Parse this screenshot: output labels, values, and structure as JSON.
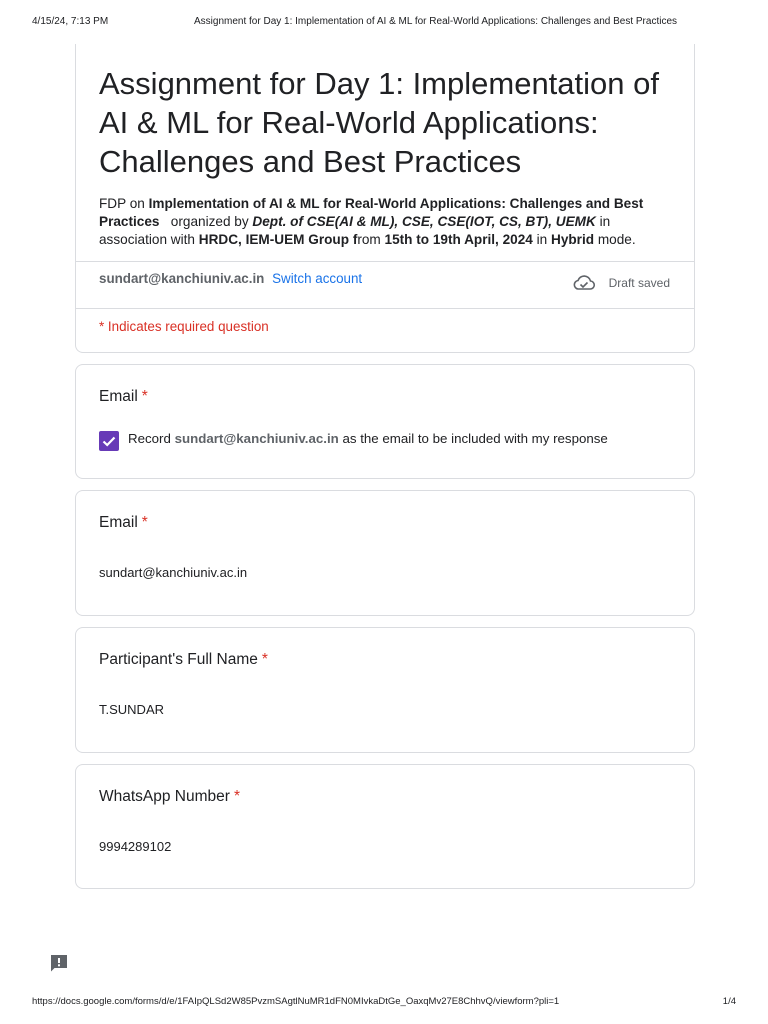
{
  "print_header": {
    "datetime": "4/15/24, 7:13 PM",
    "title": "Assignment for Day 1: Implementation of AI & ML for Real-World Applications: Challenges and Best Practices"
  },
  "form": {
    "title": "Assignment for Day 1:  Implementation of AI & ML for Real-World Applications: Challenges and Best Practices",
    "description": {
      "prefix": "FDP on ",
      "topic": "Implementation of AI & ML for Real-World Applications: Challenges and Best Practices",
      "organized_by_text": "   organized by ",
      "organizer": "Dept. of CSE(AI & ML), CSE, CSE(IOT, CS, BT), UEMK",
      "association_text": " in association with ",
      "partner": "HRDC, IEM-UEM Group ",
      "partner_f": "f",
      "rom_text": "rom ",
      "dates": "15th to 19th April, 2024",
      "in_text": " in ",
      "mode": "Hybrid",
      "mode_suffix": " mode."
    },
    "account_email": "sundart@kanchiuniv.ac.in",
    "switch_account_label": "Switch account",
    "draft_status": "Draft saved",
    "required_note": "* Indicates required question"
  },
  "questions": [
    {
      "label": "Email",
      "required_mark": "*",
      "checkbox_prefix": "Record ",
      "checkbox_email": "sundart@kanchiuniv.ac.in",
      "checkbox_suffix": " as the email to be included with my response",
      "checked": true
    },
    {
      "label": "Email",
      "required_mark": "*",
      "value": "sundart@kanchiuniv.ac.in"
    },
    {
      "label": "Participant's Full Name",
      "required_mark": "*",
      "value": "T.SUNDAR"
    },
    {
      "label": "WhatsApp Number",
      "required_mark": "*",
      "value": "9994289102"
    }
  ],
  "print_footer": {
    "url": "https://docs.google.com/forms/d/e/1FAIpQLSd2W85PvzmSAgtlNuMR1dFN0MIvkaDtGe_OaxqMv27E8ChhvQ/viewform?pli=1",
    "page": "1/4"
  },
  "colors": {
    "accent": "#673ab7",
    "required": "#d93025",
    "link": "#1a73e8",
    "border": "#dadce0"
  },
  "icons": [
    "cloud-check-icon",
    "checkmark-icon",
    "feedback-icon"
  ]
}
